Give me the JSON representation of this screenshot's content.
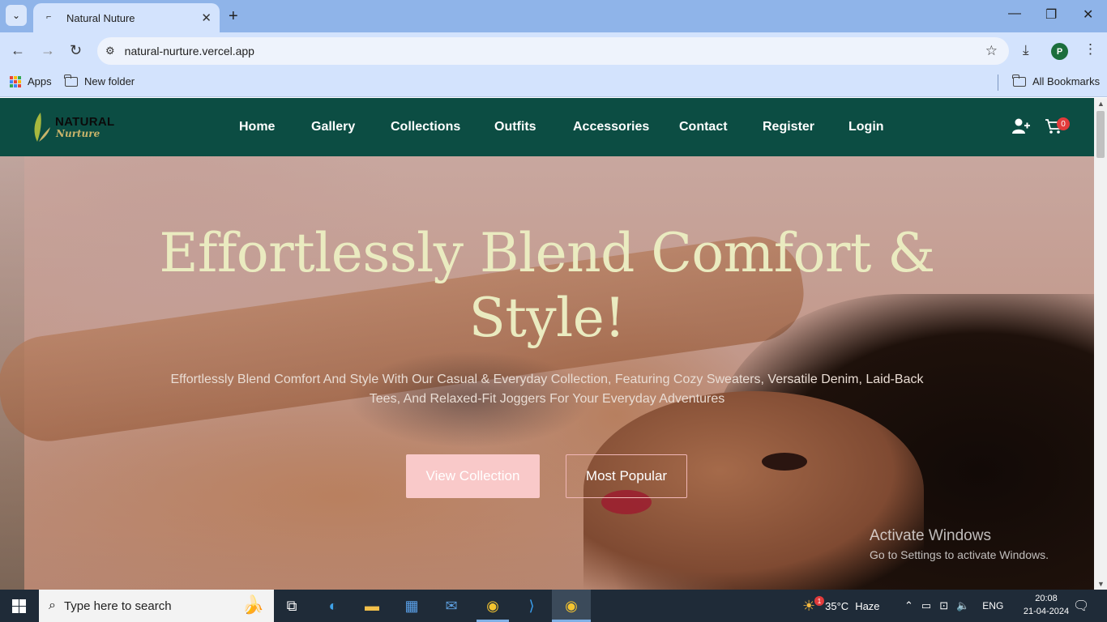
{
  "browser": {
    "tab_title": "Natural Nuture",
    "url": "natural-nurture.vercel.app",
    "bookmarks": {
      "apps": "Apps",
      "new_folder": "New folder",
      "all": "All Bookmarks"
    },
    "profile_initial": "P"
  },
  "site": {
    "logo": {
      "line1": "NATURAL",
      "line2": "Nurture"
    },
    "nav": [
      "Home",
      "Gallery",
      "Collections",
      "Outfits",
      "Accessories",
      "Contact",
      "Register",
      "Login"
    ],
    "cart_count": "0",
    "hero": {
      "title": "Effortlessly Blend Comfort & Style!",
      "subtitle": "Effortlessly Blend Comfort And Style With Our Casual & Everyday Collection, Featuring Cozy Sweaters, Versatile Denim, Laid-Back Tees, And Relaxed-Fit Joggers For Your Everyday Adventures",
      "primary_button": "View Collection",
      "secondary_button": "Most Popular"
    },
    "colors": {
      "header": "#0c4d43",
      "title": "#eaebc0",
      "primary_button": "#f9c9c9"
    }
  },
  "watermark": {
    "line1": "Activate Windows",
    "line2": "Go to Settings to activate Windows."
  },
  "taskbar": {
    "search_placeholder": "Type here to search",
    "weather": {
      "temp": "35°C",
      "condition": "Haze",
      "badge": "1"
    },
    "language": "ENG",
    "time": "20:08",
    "date": "21-04-2024"
  }
}
